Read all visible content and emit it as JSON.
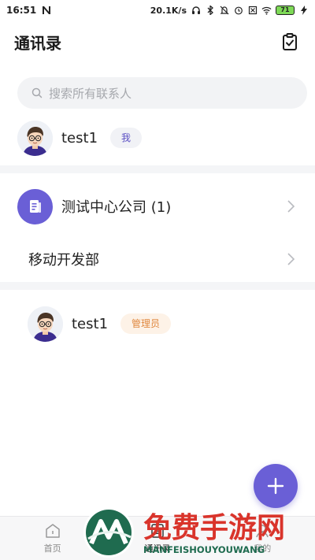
{
  "status_bar": {
    "time": "16:51",
    "speed": "20.1K/s",
    "battery": "71"
  },
  "header": {
    "title": "通讯录"
  },
  "search": {
    "placeholder": "搜索所有联系人"
  },
  "self": {
    "name": "test1",
    "tag": "我"
  },
  "company": {
    "name": "测试中心公司 (1)"
  },
  "department": {
    "name": "移动开发部"
  },
  "member": {
    "name": "test1",
    "tag": "管理员"
  },
  "bottom_nav": {
    "items": [
      {
        "label": "首页",
        "icon": "home-icon"
      },
      {
        "label": "通讯录",
        "icon": "contacts-icon"
      },
      {
        "label": "我的",
        "icon": "profile-icon"
      }
    ],
    "active_index": 1
  },
  "watermark": {
    "text": "免费手游网",
    "subtext": "MANFEISHOUYOUWANG"
  },
  "colors": {
    "accent": "#6a5fd6",
    "admin_tag": "#e0883f",
    "watermark_red": "#d9342b",
    "watermark_green": "#1f6b4f"
  }
}
